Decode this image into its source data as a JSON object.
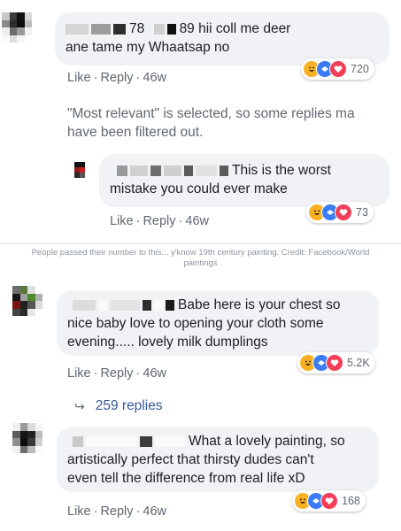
{
  "section1": {
    "comment": {
      "name_suffix": "78",
      "text_line1": "89 hii coll me deer",
      "text_line2": "ane tame my Whaatsap no",
      "like": "Like",
      "reply": "Reply",
      "age": "46w",
      "reaction_count": "720"
    },
    "filter_note_line1": "\"Most relevant\" is selected, so some replies ma",
    "filter_note_line2": "have been filtered out.",
    "reply": {
      "text_line1": "This is the worst",
      "text_line2": "mistake you could ever make",
      "like": "Like",
      "reply": "Reply",
      "age": "46w",
      "reaction_count": "73"
    }
  },
  "caption_line1": "People passed their number to this... y'know 19th century painting. Credit: Facebook/World",
  "caption_line2": "paintings",
  "section2": {
    "comment1": {
      "text_line1": "Babe here is your chest so",
      "text_line2": "nice baby love to opening your cloth some",
      "text_line3": "evening..... lovely milk dumplings",
      "like": "Like",
      "reply": "Reply",
      "age": "46w",
      "reaction_count": "5.2K"
    },
    "more_replies": "259 replies",
    "comment2": {
      "text_line1": "What a lovely painting, so",
      "text_line2": "artistically perfect that thirsty dudes can't",
      "text_line3": "even tell the difference from real life xD",
      "like": "Like",
      "reply": "Reply",
      "age": "46w",
      "reaction_count": "168"
    }
  },
  "colors": {
    "bubble_bg": "#f0f2f5",
    "action_text": "#606770",
    "link_blue": "#385898",
    "haha": "#f7b125",
    "wow": "#3b7cf5",
    "love": "#f33e58"
  },
  "icons": [
    "haha-reaction-icon",
    "wow-reaction-icon",
    "love-reaction-icon",
    "reply-arrow-icon"
  ]
}
